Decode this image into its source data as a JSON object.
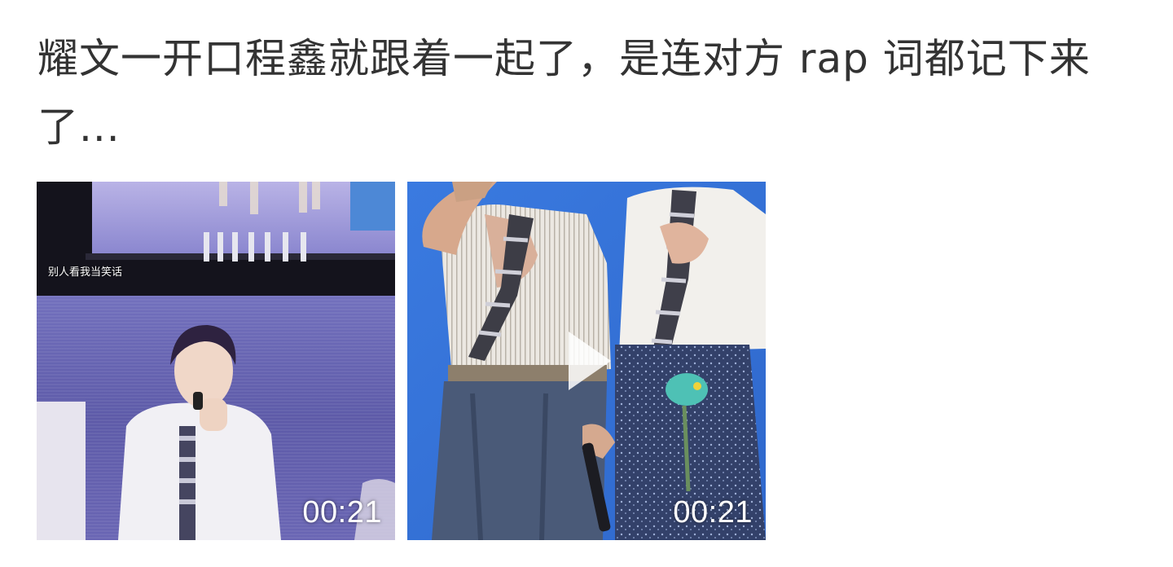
{
  "post": {
    "text": "耀文一开口程鑫就跟着一起了，是连对方 rap 词都记下来了..."
  },
  "media": [
    {
      "duration": "00:21",
      "overlay_caption": "别人看我当笑话"
    },
    {
      "duration": "00:21"
    }
  ],
  "colors": {
    "text": "#333333",
    "duration_text": "#ffffff",
    "stage_purple": "#6f6fb8",
    "stage_blue": "#2f6fd4"
  }
}
